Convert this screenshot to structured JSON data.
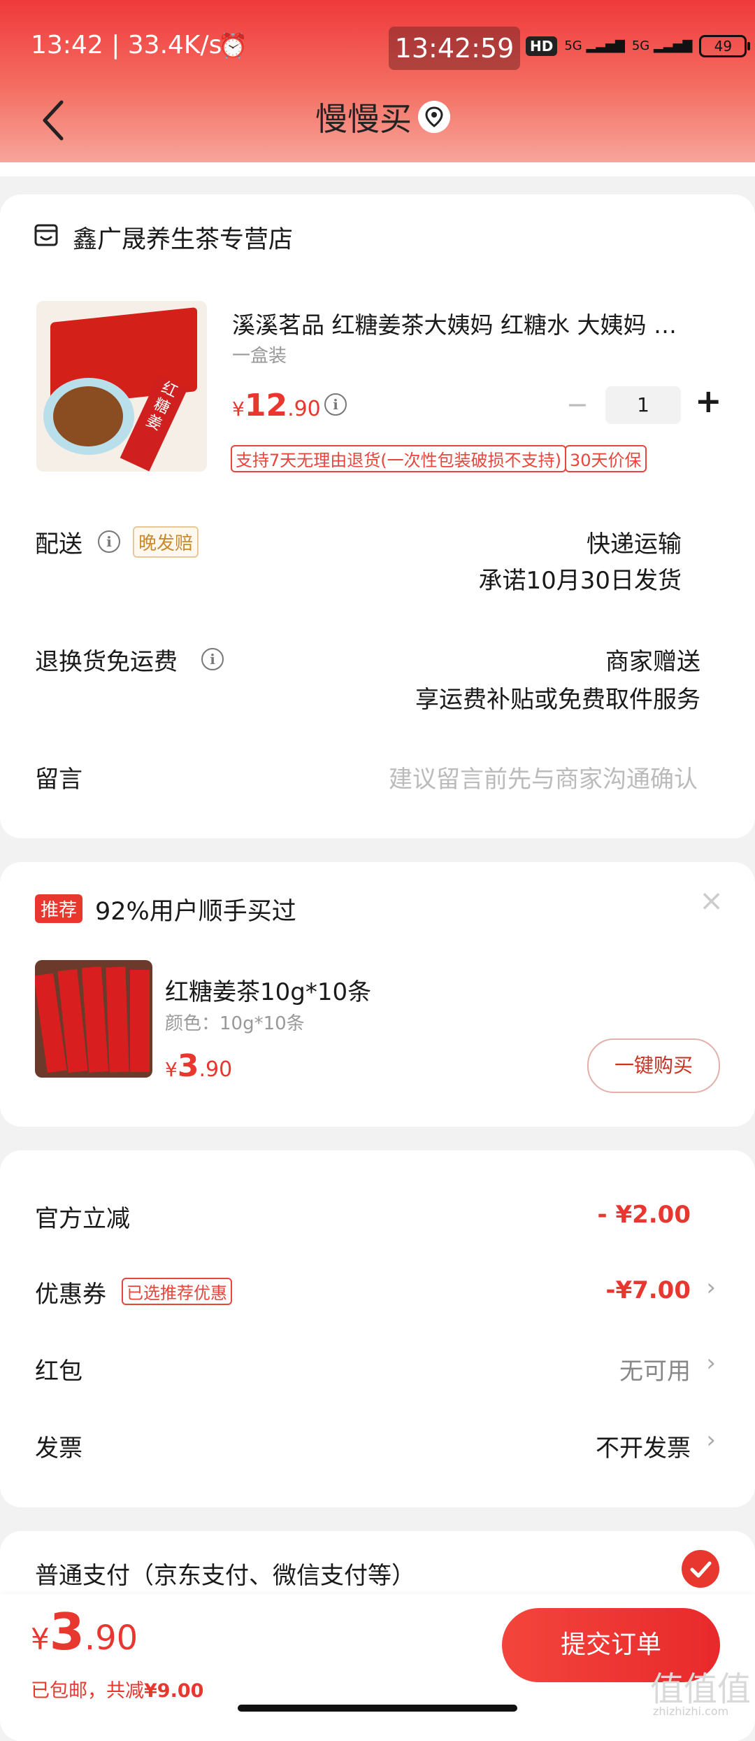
{
  "status_bar": {
    "left": "13:42 | 33.4K/s",
    "clock": "13:42:59",
    "hd": "HD",
    "net1": "5G",
    "net2": "5G",
    "battery": "49"
  },
  "nav": {
    "title": "慢慢买"
  },
  "store": {
    "name": "鑫广晟养生茶专营店",
    "product_title": "溪溪茗品 红糖姜茶大姨妈 红糖水 大姨妈 …",
    "spec": "一盒装",
    "price_symbol": "¥",
    "price_int": "12",
    "price_dec": ".90",
    "quantity": "1",
    "minus": "−",
    "plus": "+",
    "tag_return": "支持7天无理由退货(一次性包装破损不支持)",
    "tag_price_protect": "30天价保",
    "delivery_label": "配送",
    "late_badge": "晚发赔",
    "delivery_method": "快递运输",
    "delivery_promise": "承诺10月30日发货",
    "return_label": "退换货免运费",
    "return_value": "商家赠送",
    "return_sub": "享运费补贴或免费取件服务",
    "message_label": "留言",
    "message_placeholder": "建议留言前先与商家沟通确认"
  },
  "recommend": {
    "badge": "推荐",
    "heading": "92%用户顺手买过",
    "close": "×",
    "item_title": "红糖姜茶10g*10条",
    "item_spec": "颜色：10g*10条",
    "price_symbol": "¥",
    "price_int": "3",
    "price_dec": ".90",
    "buy_button": "一键购买"
  },
  "discounts": {
    "official_label": "官方立减",
    "official_value": "- ¥2.00",
    "coupon_label": "优惠券",
    "coupon_tag": "已选推荐优惠",
    "coupon_value": "-¥7.00",
    "redpacket_label": "红包",
    "redpacket_value": "无可用",
    "invoice_label": "发票",
    "invoice_value": "不开发票"
  },
  "payment": {
    "label": "普通支付（京东支付、微信支付等）"
  },
  "footer": {
    "price_symbol": "¥",
    "price_int": "3",
    "price_dec": ".90",
    "shipping": "已包邮，共减",
    "saved": "¥9.00",
    "submit": "提交订单",
    "watermark": "值值值",
    "watermark_url": "zhizhizhi.com"
  },
  "colors": {
    "accent": "#e8372e",
    "header_top": "#f0393b",
    "header_bottom": "#f7a59a"
  }
}
